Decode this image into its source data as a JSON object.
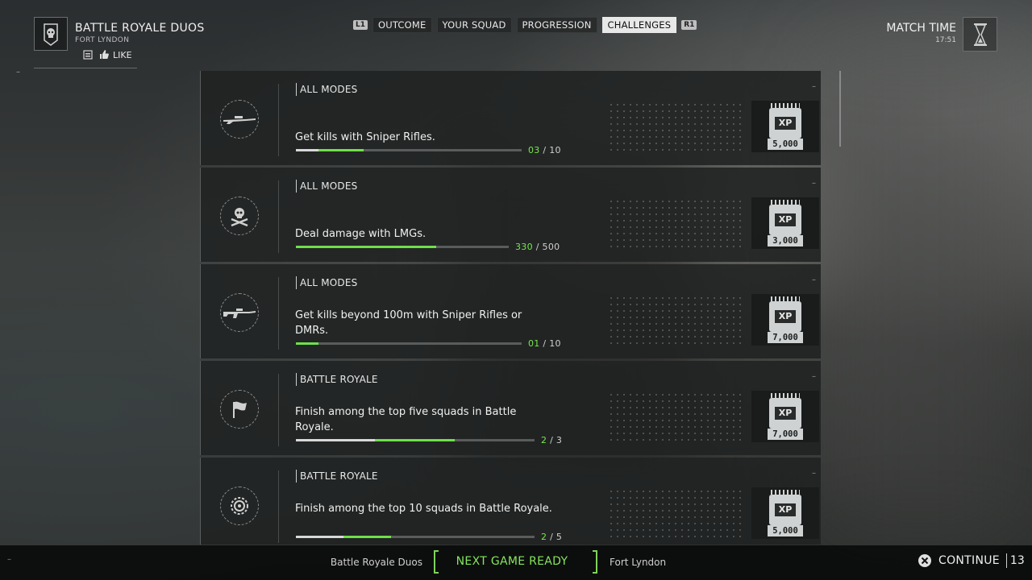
{
  "header": {
    "mode_title": "BATTLE ROYALE DUOS",
    "map_name": "FORT LYNDON",
    "like_label": "LIKE",
    "emblem_icon": "skull-emblem-icon"
  },
  "tabs": {
    "left_hint": "L1",
    "right_hint": "R1",
    "items": [
      {
        "label": "OUTCOME",
        "active": false
      },
      {
        "label": "YOUR SQUAD",
        "active": false
      },
      {
        "label": "PROGRESSION",
        "active": false
      },
      {
        "label": "CHALLENGES",
        "active": true
      }
    ]
  },
  "match_time": {
    "label": "MATCH TIME",
    "value": "17:51"
  },
  "challenges": [
    {
      "category": "ALL MODES",
      "description": "Get kills with Sniper Rifles.",
      "current": "03",
      "separator": "/",
      "target": "10",
      "progress_prior": 0.1,
      "progress_gained": 0.2,
      "reward_label": "XP",
      "reward_amount": "5,000",
      "icon": "sniper-rifle-icon"
    },
    {
      "category": "ALL MODES",
      "description": "Deal damage with LMGs.",
      "current": "330",
      "separator": "/",
      "target": "500",
      "progress_prior": 0.0,
      "progress_gained": 0.66,
      "reward_label": "XP",
      "reward_amount": "3,000",
      "icon": "skull-crossbones-icon"
    },
    {
      "category": "ALL MODES",
      "description": "Get kills beyond 100m with Sniper Rifles or DMRs.",
      "current": "01",
      "separator": "/",
      "target": "10",
      "progress_prior": 0.0,
      "progress_gained": 0.1,
      "reward_label": "XP",
      "reward_amount": "7,000",
      "icon": "dmr-rifle-icon"
    },
    {
      "category": "BATTLE ROYALE",
      "description": "Finish among the top five squads in Battle Royale.",
      "current": "2",
      "separator": "/",
      "target": "3",
      "progress_prior": 0.33,
      "progress_gained": 0.34,
      "reward_label": "XP",
      "reward_amount": "7,000",
      "icon": "flag-icon"
    },
    {
      "category": "BATTLE ROYALE",
      "description": "Finish among the top 10 squads in Battle Royale.",
      "current": "2",
      "separator": "/",
      "target": "5",
      "progress_prior": 0.2,
      "progress_gained": 0.2,
      "reward_label": "XP",
      "reward_amount": "5,000",
      "icon": "medal-icon"
    }
  ],
  "footer": {
    "mode": "Battle Royale Duos",
    "status": "NEXT GAME READY",
    "map": "Fort Lyndon",
    "continue_label": "CONTINUE",
    "countdown": "13",
    "accent_color": "#76e64f"
  }
}
